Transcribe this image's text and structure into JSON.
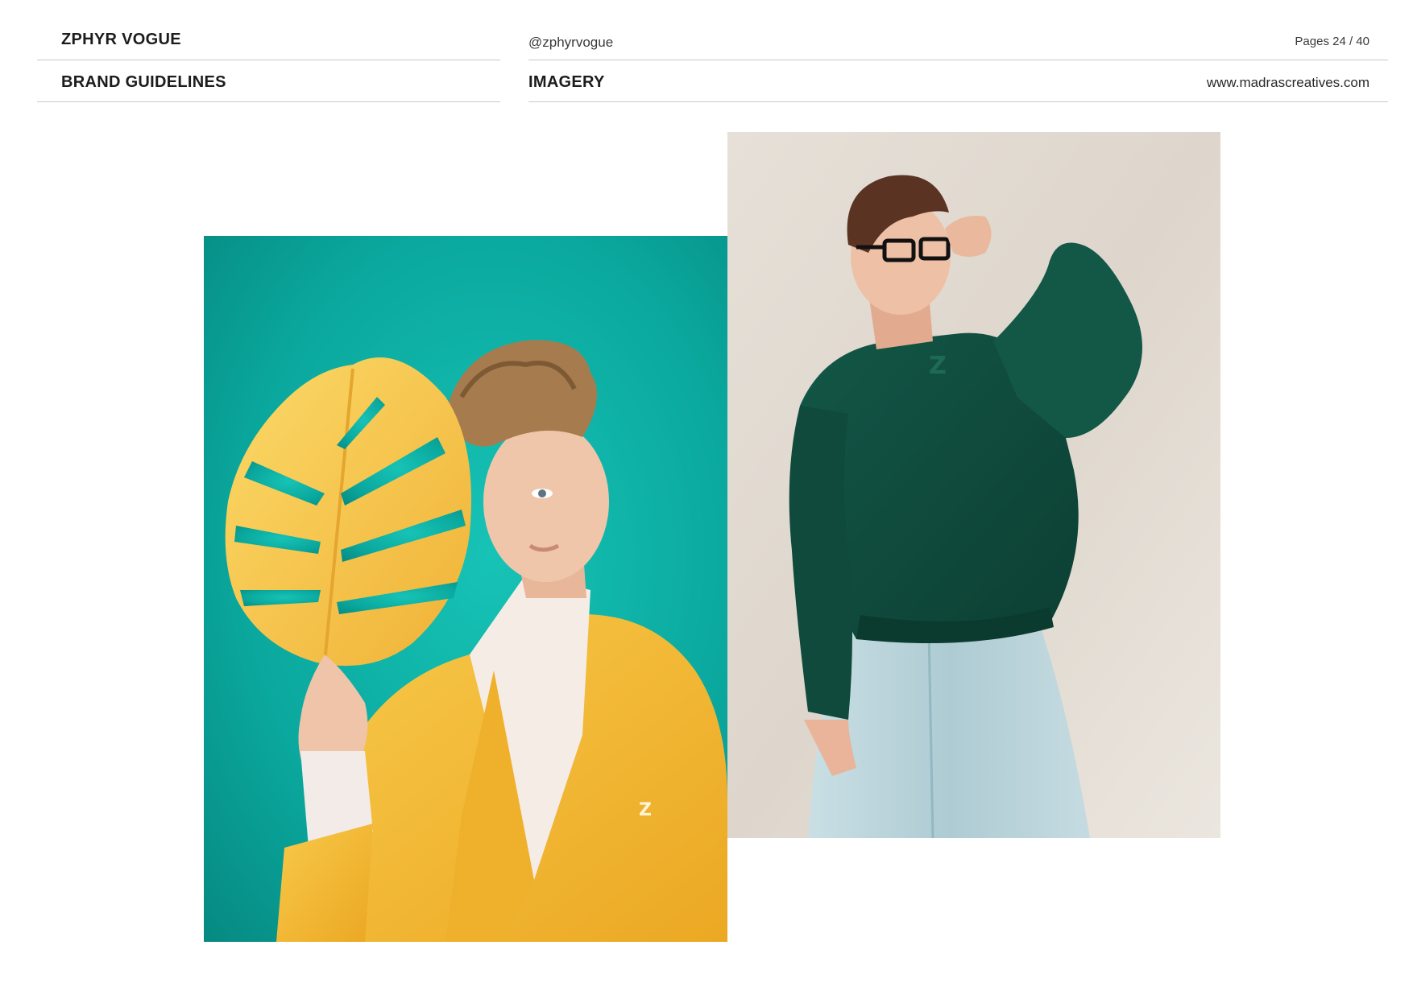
{
  "header": {
    "brand": "ZPHYR VOGUE",
    "document_title": "BRAND GUIDELINES",
    "social_handle": "@zphyrvogue",
    "page_indicator": "Pages 24 / 40",
    "section_title": "IMAGERY",
    "website": "www.madrascreatives.com"
  },
  "colors": {
    "teal_background": "#0aa79d",
    "mustard_yellow": "#f4b52f",
    "forest_green": "#0f4a3c",
    "light_denim": "#bcd6dd",
    "warm_wall": "#e2dcd3"
  }
}
